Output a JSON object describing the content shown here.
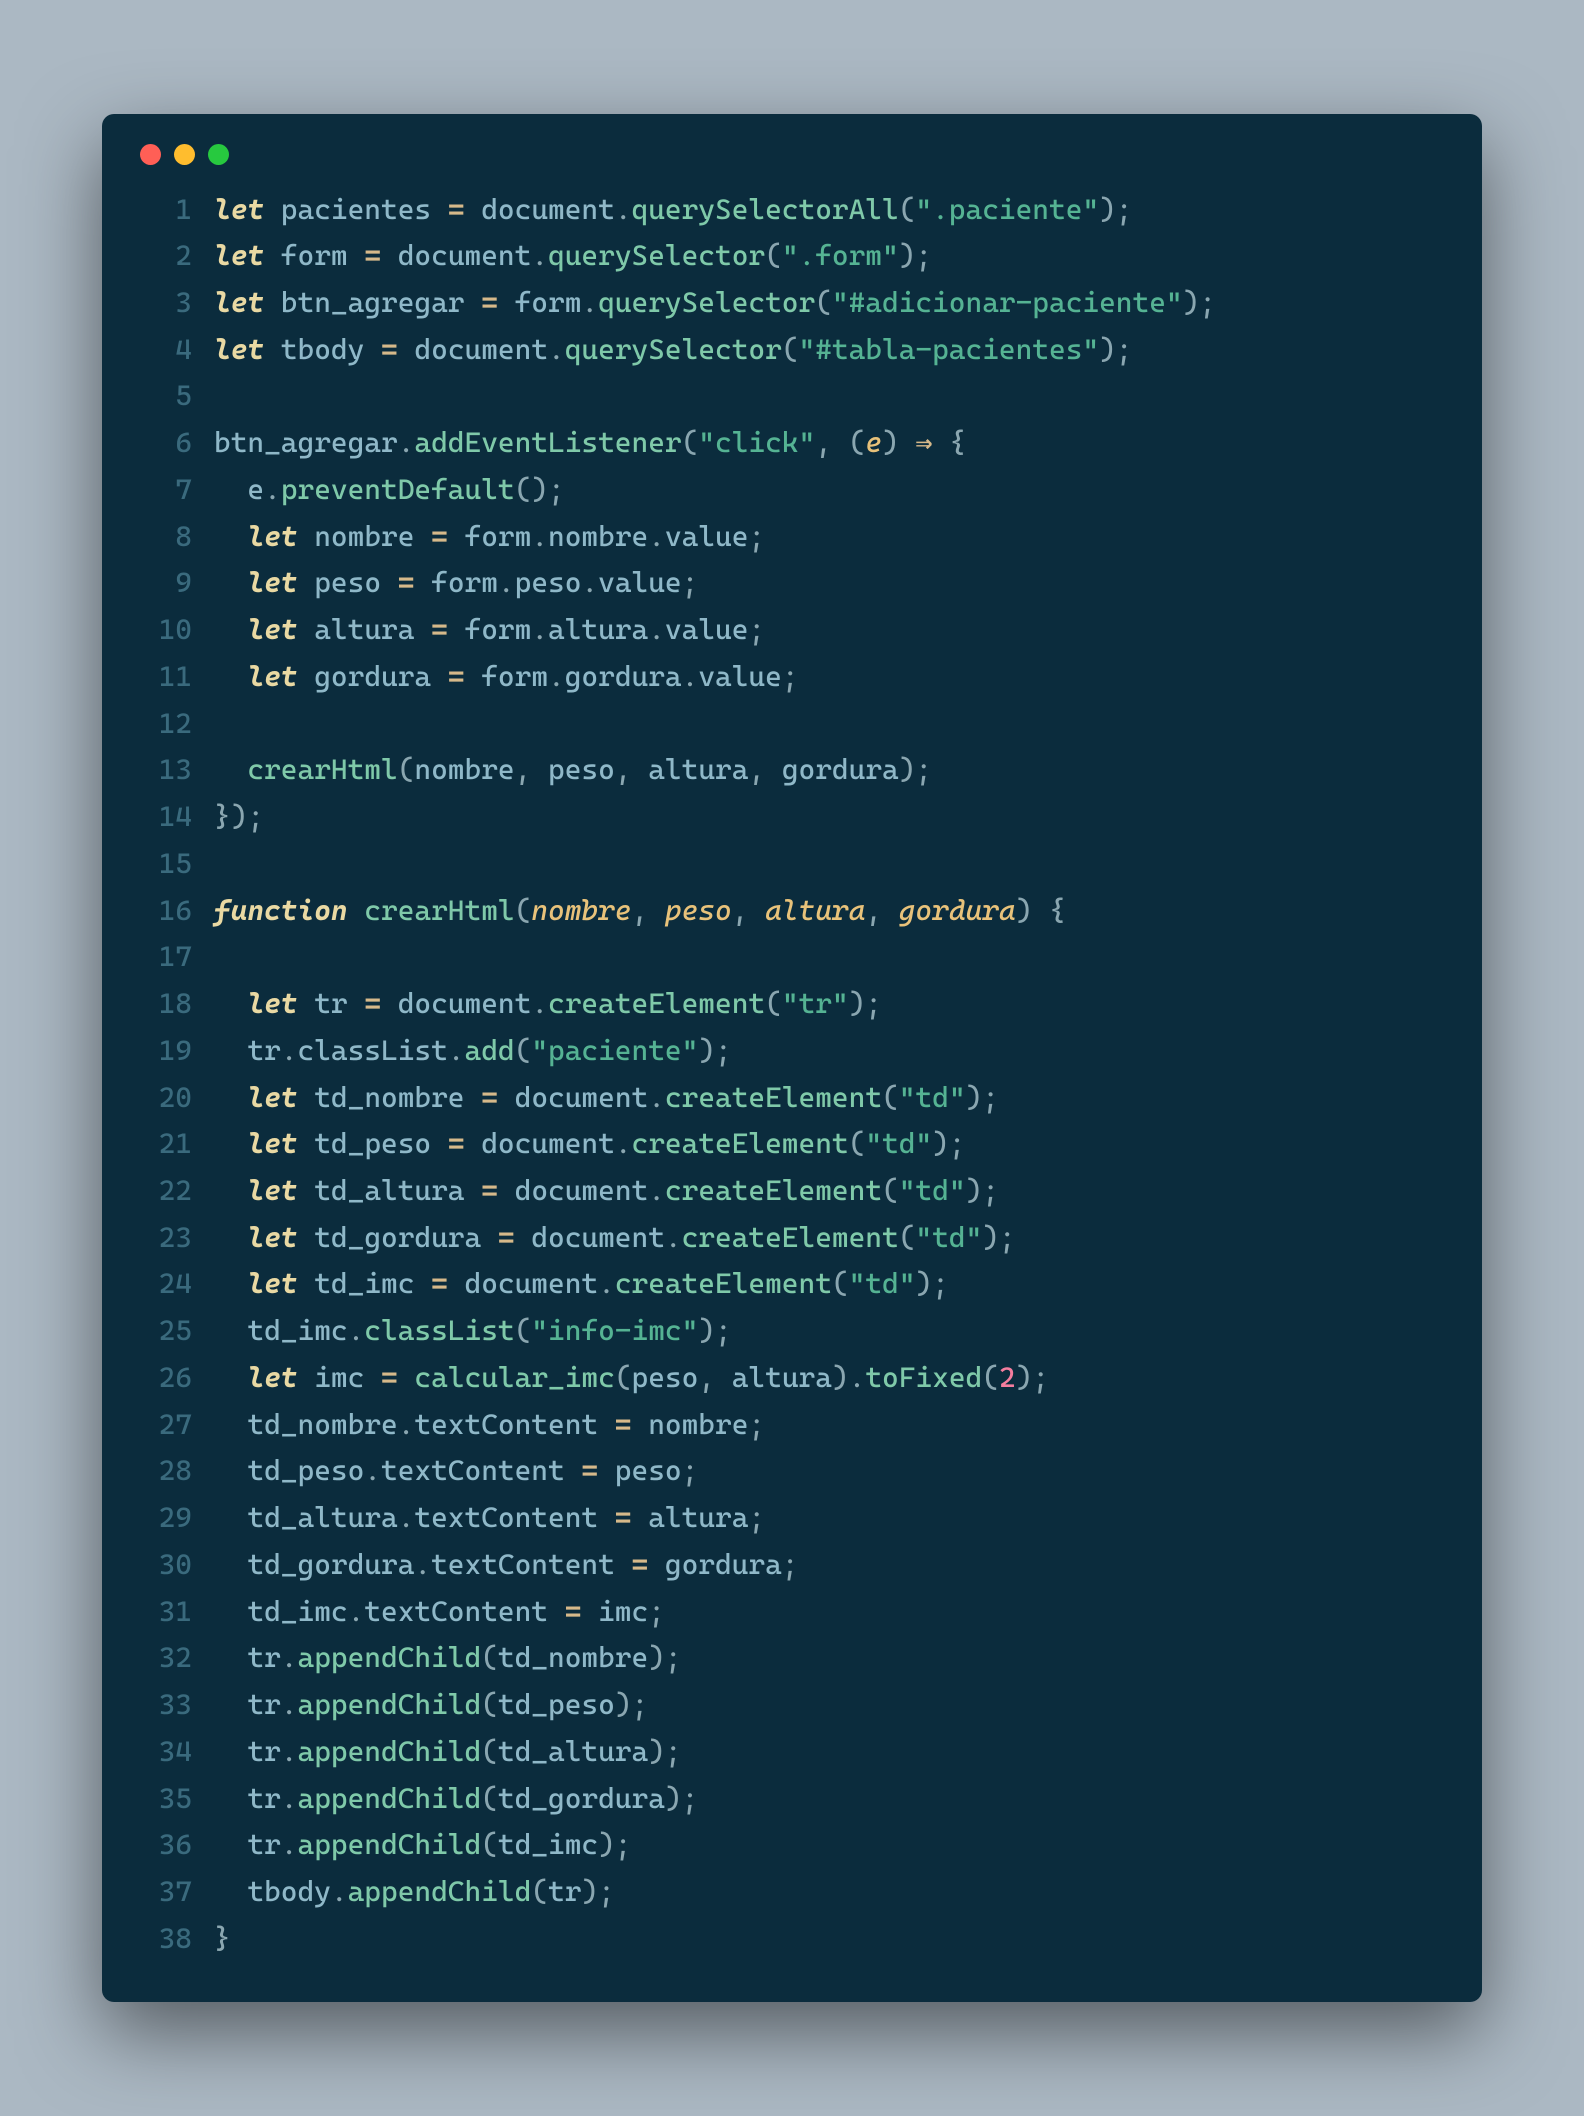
{
  "lines": [
    {
      "n": 1,
      "tokens": [
        [
          "kw",
          "let"
        ],
        [
          "",
          ""
        ],
        [
          "",
          ""
        ],
        [
          "",
          ""
        ],
        [
          "var",
          " pacientes "
        ],
        [
          "op",
          "="
        ],
        [
          "obj",
          " document"
        ],
        [
          "punc",
          "."
        ],
        [
          "fn",
          "querySelectorAll"
        ],
        [
          "punc",
          "("
        ],
        [
          "str",
          "\".paciente\""
        ],
        [
          "punc",
          ");"
        ]
      ]
    },
    {
      "n": 2,
      "tokens": [
        [
          "kw",
          "let"
        ],
        [
          "var",
          " form "
        ],
        [
          "op",
          "="
        ],
        [
          "obj",
          " document"
        ],
        [
          "punc",
          "."
        ],
        [
          "fn",
          "querySelector"
        ],
        [
          "punc",
          "("
        ],
        [
          "str",
          "\".form\""
        ],
        [
          "punc",
          ");"
        ]
      ]
    },
    {
      "n": 3,
      "tokens": [
        [
          "kw",
          "let"
        ],
        [
          "var",
          " btn_agregar "
        ],
        [
          "op",
          "="
        ],
        [
          "obj",
          " form"
        ],
        [
          "punc",
          "."
        ],
        [
          "fn",
          "querySelector"
        ],
        [
          "punc",
          "("
        ],
        [
          "str",
          "\"#adicionar-paciente\""
        ],
        [
          "punc",
          ");"
        ]
      ]
    },
    {
      "n": 4,
      "tokens": [
        [
          "kw",
          "let"
        ],
        [
          "var",
          " tbody "
        ],
        [
          "op",
          "="
        ],
        [
          "obj",
          " document"
        ],
        [
          "punc",
          "."
        ],
        [
          "fn",
          "querySelector"
        ],
        [
          "punc",
          "("
        ],
        [
          "str",
          "\"#tabla-pacientes\""
        ],
        [
          "punc",
          ");"
        ]
      ]
    },
    {
      "n": 5,
      "tokens": []
    },
    {
      "n": 6,
      "tokens": [
        [
          "obj",
          "btn_agregar"
        ],
        [
          "punc",
          "."
        ],
        [
          "fn",
          "addEventListener"
        ],
        [
          "punc",
          "("
        ],
        [
          "str",
          "\"click\""
        ],
        [
          "punc",
          ", ("
        ],
        [
          "param",
          "e"
        ],
        [
          "punc",
          ") "
        ],
        [
          "arrow",
          "⇒"
        ],
        [
          "punc",
          " {"
        ]
      ]
    },
    {
      "n": 7,
      "tokens": [
        [
          "obj",
          "  e"
        ],
        [
          "punc",
          "."
        ],
        [
          "fn",
          "preventDefault"
        ],
        [
          "punc",
          "();"
        ]
      ]
    },
    {
      "n": 8,
      "tokens": [
        [
          "",
          "  "
        ],
        [
          "kw",
          "let"
        ],
        [
          "var",
          " nombre "
        ],
        [
          "op",
          "="
        ],
        [
          "obj",
          " form"
        ],
        [
          "punc",
          "."
        ],
        [
          "obj",
          "nombre"
        ],
        [
          "punc",
          "."
        ],
        [
          "obj",
          "value"
        ],
        [
          "punc",
          ";"
        ]
      ]
    },
    {
      "n": 9,
      "tokens": [
        [
          "",
          "  "
        ],
        [
          "kw",
          "let"
        ],
        [
          "var",
          " peso "
        ],
        [
          "op",
          "="
        ],
        [
          "obj",
          " form"
        ],
        [
          "punc",
          "."
        ],
        [
          "obj",
          "peso"
        ],
        [
          "punc",
          "."
        ],
        [
          "obj",
          "value"
        ],
        [
          "punc",
          ";"
        ]
      ]
    },
    {
      "n": 10,
      "tokens": [
        [
          "",
          "  "
        ],
        [
          "kw",
          "let"
        ],
        [
          "var",
          " altura "
        ],
        [
          "op",
          "="
        ],
        [
          "obj",
          " form"
        ],
        [
          "punc",
          "."
        ],
        [
          "obj",
          "altura"
        ],
        [
          "punc",
          "."
        ],
        [
          "obj",
          "value"
        ],
        [
          "punc",
          ";"
        ]
      ]
    },
    {
      "n": 11,
      "tokens": [
        [
          "",
          "  "
        ],
        [
          "kw",
          "let"
        ],
        [
          "var",
          " gordura "
        ],
        [
          "op",
          "="
        ],
        [
          "obj",
          " form"
        ],
        [
          "punc",
          "."
        ],
        [
          "obj",
          "gordura"
        ],
        [
          "punc",
          "."
        ],
        [
          "obj",
          "value"
        ],
        [
          "punc",
          ";"
        ]
      ]
    },
    {
      "n": 12,
      "tokens": []
    },
    {
      "n": 13,
      "tokens": [
        [
          "",
          "  "
        ],
        [
          "fn",
          "crearHtml"
        ],
        [
          "punc",
          "("
        ],
        [
          "obj",
          "nombre"
        ],
        [
          "punc",
          ", "
        ],
        [
          "obj",
          "peso"
        ],
        [
          "punc",
          ", "
        ],
        [
          "obj",
          "altura"
        ],
        [
          "punc",
          ", "
        ],
        [
          "obj",
          "gordura"
        ],
        [
          "punc",
          ");"
        ]
      ]
    },
    {
      "n": 14,
      "tokens": [
        [
          "punc",
          "});"
        ]
      ]
    },
    {
      "n": 15,
      "tokens": []
    },
    {
      "n": 16,
      "tokens": [
        [
          "kw",
          "function"
        ],
        [
          "fn",
          " crearHtml"
        ],
        [
          "punc",
          "("
        ],
        [
          "param",
          "nombre"
        ],
        [
          "punc",
          ", "
        ],
        [
          "param",
          "peso"
        ],
        [
          "punc",
          ", "
        ],
        [
          "param",
          "altura"
        ],
        [
          "punc",
          ", "
        ],
        [
          "param",
          "gordura"
        ],
        [
          "punc",
          ") {"
        ]
      ]
    },
    {
      "n": 17,
      "tokens": []
    },
    {
      "n": 18,
      "tokens": [
        [
          "",
          "  "
        ],
        [
          "kw",
          "let"
        ],
        [
          "var",
          " tr "
        ],
        [
          "op",
          "="
        ],
        [
          "obj",
          " document"
        ],
        [
          "punc",
          "."
        ],
        [
          "fn",
          "createElement"
        ],
        [
          "punc",
          "("
        ],
        [
          "str",
          "\"tr\""
        ],
        [
          "punc",
          ");"
        ]
      ]
    },
    {
      "n": 19,
      "tokens": [
        [
          "obj",
          "  tr"
        ],
        [
          "punc",
          "."
        ],
        [
          "obj",
          "classList"
        ],
        [
          "punc",
          "."
        ],
        [
          "fn",
          "add"
        ],
        [
          "punc",
          "("
        ],
        [
          "str",
          "\"paciente\""
        ],
        [
          "punc",
          ");"
        ]
      ]
    },
    {
      "n": 20,
      "tokens": [
        [
          "",
          "  "
        ],
        [
          "kw",
          "let"
        ],
        [
          "var",
          " td_nombre "
        ],
        [
          "op",
          "="
        ],
        [
          "obj",
          " document"
        ],
        [
          "punc",
          "."
        ],
        [
          "fn",
          "createElement"
        ],
        [
          "punc",
          "("
        ],
        [
          "str",
          "\"td\""
        ],
        [
          "punc",
          ");"
        ]
      ]
    },
    {
      "n": 21,
      "tokens": [
        [
          "",
          "  "
        ],
        [
          "kw",
          "let"
        ],
        [
          "var",
          " td_peso "
        ],
        [
          "op",
          "="
        ],
        [
          "obj",
          " document"
        ],
        [
          "punc",
          "."
        ],
        [
          "fn",
          "createElement"
        ],
        [
          "punc",
          "("
        ],
        [
          "str",
          "\"td\""
        ],
        [
          "punc",
          ");"
        ]
      ]
    },
    {
      "n": 22,
      "tokens": [
        [
          "",
          "  "
        ],
        [
          "kw",
          "let"
        ],
        [
          "var",
          " td_altura "
        ],
        [
          "op",
          "="
        ],
        [
          "obj",
          " document"
        ],
        [
          "punc",
          "."
        ],
        [
          "fn",
          "createElement"
        ],
        [
          "punc",
          "("
        ],
        [
          "str",
          "\"td\""
        ],
        [
          "punc",
          ");"
        ]
      ]
    },
    {
      "n": 23,
      "tokens": [
        [
          "",
          "  "
        ],
        [
          "kw",
          "let"
        ],
        [
          "var",
          " td_gordura "
        ],
        [
          "op",
          "="
        ],
        [
          "obj",
          " document"
        ],
        [
          "punc",
          "."
        ],
        [
          "fn",
          "createElement"
        ],
        [
          "punc",
          "("
        ],
        [
          "str",
          "\"td\""
        ],
        [
          "punc",
          ");"
        ]
      ]
    },
    {
      "n": 24,
      "tokens": [
        [
          "",
          "  "
        ],
        [
          "kw",
          "let"
        ],
        [
          "var",
          " td_imc "
        ],
        [
          "op",
          "="
        ],
        [
          "obj",
          " document"
        ],
        [
          "punc",
          "."
        ],
        [
          "fn",
          "createElement"
        ],
        [
          "punc",
          "("
        ],
        [
          "str",
          "\"td\""
        ],
        [
          "punc",
          ");"
        ]
      ]
    },
    {
      "n": 25,
      "tokens": [
        [
          "obj",
          "  td_imc"
        ],
        [
          "punc",
          "."
        ],
        [
          "fn",
          "classList"
        ],
        [
          "punc",
          "("
        ],
        [
          "str",
          "\"info-imc\""
        ],
        [
          "punc",
          ");"
        ]
      ]
    },
    {
      "n": 26,
      "tokens": [
        [
          "",
          "  "
        ],
        [
          "kw",
          "let"
        ],
        [
          "var",
          " imc "
        ],
        [
          "op",
          "="
        ],
        [
          "fn",
          " calcular_imc"
        ],
        [
          "punc",
          "("
        ],
        [
          "obj",
          "peso"
        ],
        [
          "punc",
          ", "
        ],
        [
          "obj",
          "altura"
        ],
        [
          "punc",
          ")."
        ],
        [
          "fn",
          "toFixed"
        ],
        [
          "punc",
          "("
        ],
        [
          "num",
          "2"
        ],
        [
          "punc",
          ");"
        ]
      ]
    },
    {
      "n": 27,
      "tokens": [
        [
          "obj",
          "  td_nombre"
        ],
        [
          "punc",
          "."
        ],
        [
          "obj",
          "textContent "
        ],
        [
          "op",
          "="
        ],
        [
          "obj",
          " nombre"
        ],
        [
          "punc",
          ";"
        ]
      ]
    },
    {
      "n": 28,
      "tokens": [
        [
          "obj",
          "  td_peso"
        ],
        [
          "punc",
          "."
        ],
        [
          "obj",
          "textContent "
        ],
        [
          "op",
          "="
        ],
        [
          "obj",
          " peso"
        ],
        [
          "punc",
          ";"
        ]
      ]
    },
    {
      "n": 29,
      "tokens": [
        [
          "obj",
          "  td_altura"
        ],
        [
          "punc",
          "."
        ],
        [
          "obj",
          "textContent "
        ],
        [
          "op",
          "="
        ],
        [
          "obj",
          " altura"
        ],
        [
          "punc",
          ";"
        ]
      ]
    },
    {
      "n": 30,
      "tokens": [
        [
          "obj",
          "  td_gordura"
        ],
        [
          "punc",
          "."
        ],
        [
          "obj",
          "textContent "
        ],
        [
          "op",
          "="
        ],
        [
          "obj",
          " gordura"
        ],
        [
          "punc",
          ";"
        ]
      ]
    },
    {
      "n": 31,
      "tokens": [
        [
          "obj",
          "  td_imc"
        ],
        [
          "punc",
          "."
        ],
        [
          "obj",
          "textContent "
        ],
        [
          "op",
          "="
        ],
        [
          "obj",
          " imc"
        ],
        [
          "punc",
          ";"
        ]
      ]
    },
    {
      "n": 32,
      "tokens": [
        [
          "obj",
          "  tr"
        ],
        [
          "punc",
          "."
        ],
        [
          "fn",
          "appendChild"
        ],
        [
          "punc",
          "("
        ],
        [
          "obj",
          "td_nombre"
        ],
        [
          "punc",
          ");"
        ]
      ]
    },
    {
      "n": 33,
      "tokens": [
        [
          "obj",
          "  tr"
        ],
        [
          "punc",
          "."
        ],
        [
          "fn",
          "appendChild"
        ],
        [
          "punc",
          "("
        ],
        [
          "obj",
          "td_peso"
        ],
        [
          "punc",
          ");"
        ]
      ]
    },
    {
      "n": 34,
      "tokens": [
        [
          "obj",
          "  tr"
        ],
        [
          "punc",
          "."
        ],
        [
          "fn",
          "appendChild"
        ],
        [
          "punc",
          "("
        ],
        [
          "obj",
          "td_altura"
        ],
        [
          "punc",
          ");"
        ]
      ]
    },
    {
      "n": 35,
      "tokens": [
        [
          "obj",
          "  tr"
        ],
        [
          "punc",
          "."
        ],
        [
          "fn",
          "appendChild"
        ],
        [
          "punc",
          "("
        ],
        [
          "obj",
          "td_gordura"
        ],
        [
          "punc",
          ");"
        ]
      ]
    },
    {
      "n": 36,
      "tokens": [
        [
          "obj",
          "  tr"
        ],
        [
          "punc",
          "."
        ],
        [
          "fn",
          "appendChild"
        ],
        [
          "punc",
          "("
        ],
        [
          "obj",
          "td_imc"
        ],
        [
          "punc",
          ");"
        ]
      ]
    },
    {
      "n": 37,
      "tokens": [
        [
          "obj",
          "  tbody"
        ],
        [
          "punc",
          "."
        ],
        [
          "fn",
          "appendChild"
        ],
        [
          "punc",
          "("
        ],
        [
          "obj",
          "tr"
        ],
        [
          "punc",
          ");"
        ]
      ]
    },
    {
      "n": 38,
      "tokens": [
        [
          "punc",
          "}"
        ]
      ]
    }
  ]
}
